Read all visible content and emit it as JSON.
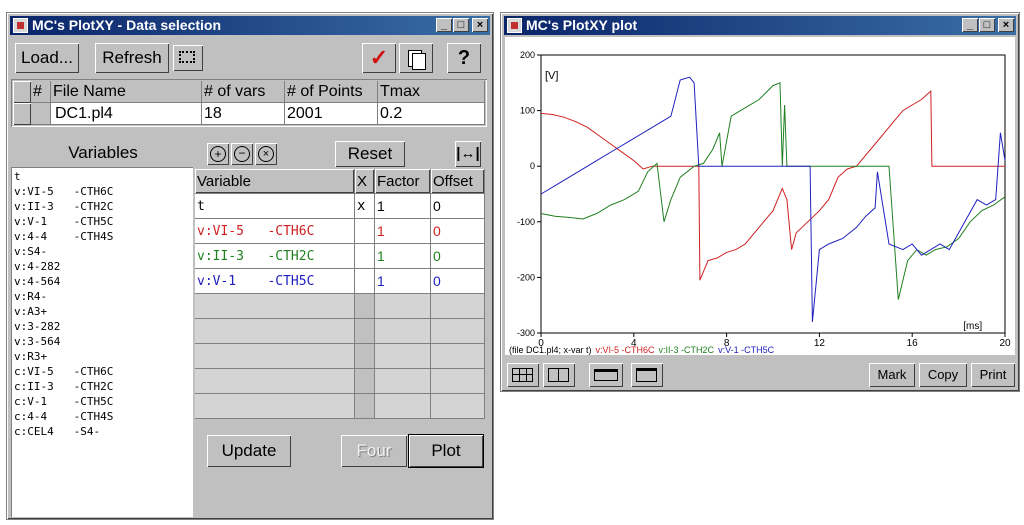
{
  "left_window": {
    "title": "MC's PlotXY - Data selection",
    "toolbar": {
      "load": "Load...",
      "refresh": "Refresh",
      "help": "?"
    },
    "file_table": {
      "headers": [
        "#",
        "File Name",
        "# of vars",
        "# of Points",
        "Tmax"
      ],
      "rows": [
        {
          "num": "",
          "file": "DC1.pl4",
          "vars": "18",
          "points": "2001",
          "tmax": "0.2"
        }
      ]
    },
    "variables_label": "Variables",
    "reset": "Reset",
    "variables": [
      "t",
      "v:VI-5   -CTH6C",
      "v:II-3   -CTH2C",
      "v:V-1    -CTH5C",
      "v:4-4    -CTH4S",
      "v:S4-",
      "v:4-282",
      "v:4-564",
      "v:R4-",
      "v:A3+",
      "v:3-282",
      "v:3-564",
      "v:R3+",
      "c:VI-5   -CTH6C",
      "c:II-3   -CTH2C",
      "c:V-1    -CTH5C",
      "c:4-4    -CTH4S",
      "c:CEL4   -S4-"
    ],
    "sel_table": {
      "headers": [
        "Variable",
        "X",
        "Factor",
        "Offset"
      ],
      "rows": [
        {
          "variable": "t",
          "x": "x",
          "factor": "1",
          "offset": "0",
          "color": "#000000"
        },
        {
          "variable": "v:VI-5   -CTH6C",
          "x": "",
          "factor": "1",
          "offset": "0",
          "color": "#d02020"
        },
        {
          "variable": "v:II-3   -CTH2C",
          "x": "",
          "factor": "1",
          "offset": "0",
          "color": "#208020"
        },
        {
          "variable": "v:V-1    -CTH5C",
          "x": "",
          "factor": "1",
          "offset": "0",
          "color": "#2020c0"
        }
      ]
    },
    "update": "Update",
    "four": "Four",
    "plot": "Plot"
  },
  "right_window": {
    "title": "MC's PlotXY plot",
    "mark": "Mark",
    "copy": "Copy",
    "print": "Print",
    "caption_prefix": "(file DC1.pl4; x-var t)",
    "legend": [
      {
        "label": "v:VI-5 -CTH6C",
        "color": "#d02020"
      },
      {
        "label": "v:II-3 -CTH2C",
        "color": "#208020"
      },
      {
        "label": "v:V-1 -CTH5C",
        "color": "#2020c0"
      }
    ]
  },
  "chart_data": {
    "type": "line",
    "ylabel": "[V]",
    "xunit": "[ms]",
    "xlim": [
      0,
      20
    ],
    "ylim": [
      -300,
      200
    ],
    "xticks": [
      0,
      4,
      8,
      12,
      16,
      20
    ],
    "yticks": [
      200,
      100,
      0,
      -100,
      -200,
      -300
    ],
    "grid": false,
    "series": [
      {
        "name": "v:VI-5 -CTH6C",
        "color": "#d02020",
        "x": [
          0,
          0.5,
          1,
          1.5,
          2,
          2.5,
          3,
          3.5,
          4,
          4.4,
          4.8,
          5.2,
          5.6,
          6.0,
          6.3,
          6.6,
          6.8,
          6.85,
          7.2,
          7.6,
          8.0,
          8.4,
          8.8,
          9.2,
          9.6,
          10.0,
          10.4,
          10.6,
          10.8,
          11.0,
          11.5,
          12,
          12.4,
          12.8,
          13.2,
          13.6,
          14.0,
          14.4,
          14.8,
          15.2,
          15.6,
          16.0,
          16.4,
          16.8,
          16.85,
          17.5,
          18,
          19,
          20
        ],
        "y": [
          95,
          93,
          88,
          80,
          70,
          55,
          40,
          25,
          10,
          -5,
          0,
          0,
          0,
          0,
          0,
          0,
          0,
          -205,
          -170,
          -165,
          -155,
          -150,
          -140,
          -120,
          -100,
          -80,
          -40,
          -60,
          -150,
          -120,
          -100,
          -80,
          -60,
          -20,
          -5,
          0,
          20,
          40,
          60,
          80,
          100,
          110,
          120,
          135,
          0,
          0,
          0,
          0,
          0
        ]
      },
      {
        "name": "v:II-3 -CTH2C",
        "color": "#208020",
        "x": [
          0,
          0.6,
          1.2,
          1.8,
          2.4,
          3.0,
          3.6,
          4.2,
          4.6,
          5.0,
          5.3,
          5.6,
          6.0,
          6.6,
          7.0,
          7.4,
          7.7,
          7.8,
          8.2,
          8.8,
          9.4,
          10.0,
          10.3,
          10.4,
          10.5,
          10.6,
          11,
          12,
          13,
          14,
          15,
          15.4,
          15.8,
          16.2,
          16.6,
          17,
          17.5,
          18,
          18.5,
          19,
          19.5,
          20
        ],
        "y": [
          -85,
          -90,
          -92,
          -95,
          -85,
          -70,
          -60,
          -45,
          -10,
          5,
          -100,
          -60,
          -20,
          0,
          5,
          30,
          60,
          0,
          90,
          105,
          120,
          145,
          150,
          0,
          110,
          0,
          0,
          0,
          0,
          0,
          0,
          -240,
          -170,
          -150,
          -160,
          -150,
          -145,
          -130,
          -100,
          -80,
          -70,
          -55
        ]
      },
      {
        "name": "v:V-1 -CTH5C",
        "color": "#2020c0",
        "x": [
          0,
          0.8,
          1.6,
          2.4,
          3.2,
          4.0,
          4.8,
          5.6,
          6.0,
          6.4,
          6.6,
          6.8,
          7,
          8,
          9,
          10,
          11,
          11.6,
          11.7,
          12.0,
          12.4,
          13.0,
          13.6,
          14.0,
          14.4,
          14.5,
          15.0,
          15.6,
          16.0,
          16.4,
          16.8,
          17.2,
          17.6,
          18.0,
          18.4,
          18.8,
          19.2,
          19.6,
          19.8,
          20
        ],
        "y": [
          -50,
          -30,
          -10,
          10,
          30,
          50,
          70,
          90,
          155,
          160,
          150,
          0,
          0,
          0,
          0,
          0,
          0,
          0,
          -280,
          -150,
          -140,
          -130,
          -110,
          -90,
          -75,
          -10,
          -140,
          -150,
          -140,
          -160,
          -150,
          -140,
          -150,
          -120,
          -90,
          -60,
          -70,
          -60,
          60,
          10
        ]
      }
    ]
  }
}
